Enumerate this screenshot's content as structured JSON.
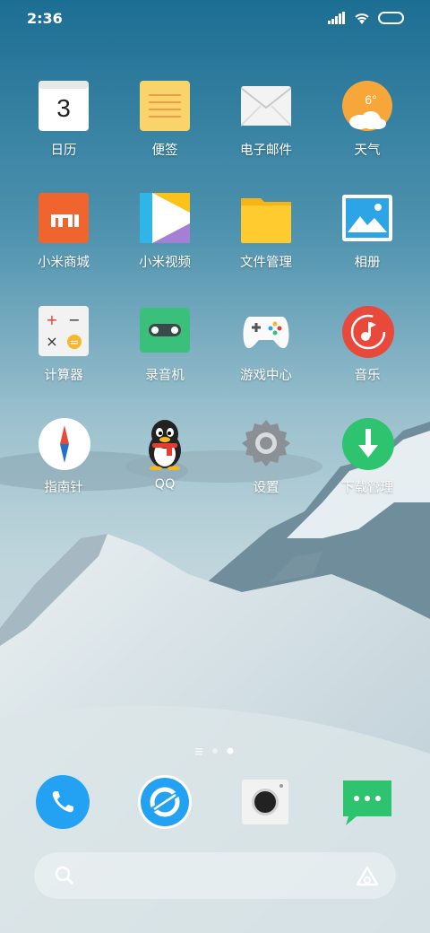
{
  "status_bar": {
    "time": "2:36"
  },
  "colors": {
    "accent_blue": "#23A1F2",
    "green": "#2EC36E",
    "red": "#E8493B",
    "orange": "#F57C3B"
  },
  "apps": [
    {
      "label": "日历",
      "icon": "calendar-icon",
      "date": "3"
    },
    {
      "label": "便签",
      "icon": "notes-icon"
    },
    {
      "label": "电子邮件",
      "icon": "email-icon"
    },
    {
      "label": "天气",
      "icon": "weather-icon",
      "temp": "6°"
    },
    {
      "label": "小米商城",
      "icon": "mi-store-icon",
      "logo": "mi"
    },
    {
      "label": "小米视频",
      "icon": "mi-video-icon"
    },
    {
      "label": "文件管理",
      "icon": "file-manager-icon"
    },
    {
      "label": "相册",
      "icon": "gallery-icon"
    },
    {
      "label": "计算器",
      "icon": "calculator-icon",
      "keys": [
        "+",
        "−",
        "×",
        "="
      ]
    },
    {
      "label": "录音机",
      "icon": "recorder-icon"
    },
    {
      "label": "游戏中心",
      "icon": "game-center-icon"
    },
    {
      "label": "音乐",
      "icon": "music-icon"
    },
    {
      "label": "指南针",
      "icon": "compass-icon"
    },
    {
      "label": "QQ",
      "icon": "qq-icon"
    },
    {
      "label": "设置",
      "icon": "settings-icon"
    },
    {
      "label": "下载管理",
      "icon": "download-manager-icon"
    }
  ],
  "page_indicator": {
    "pages": 2,
    "current": 2
  },
  "dock": [
    {
      "name": "phone",
      "icon": "phone-icon"
    },
    {
      "name": "browser",
      "icon": "browser-icon"
    },
    {
      "name": "camera",
      "icon": "camera-icon"
    },
    {
      "name": "messages",
      "icon": "messages-icon"
    }
  ],
  "search_bar": {
    "left_icon": "search-icon",
    "right_icon": "assistant-icon"
  }
}
